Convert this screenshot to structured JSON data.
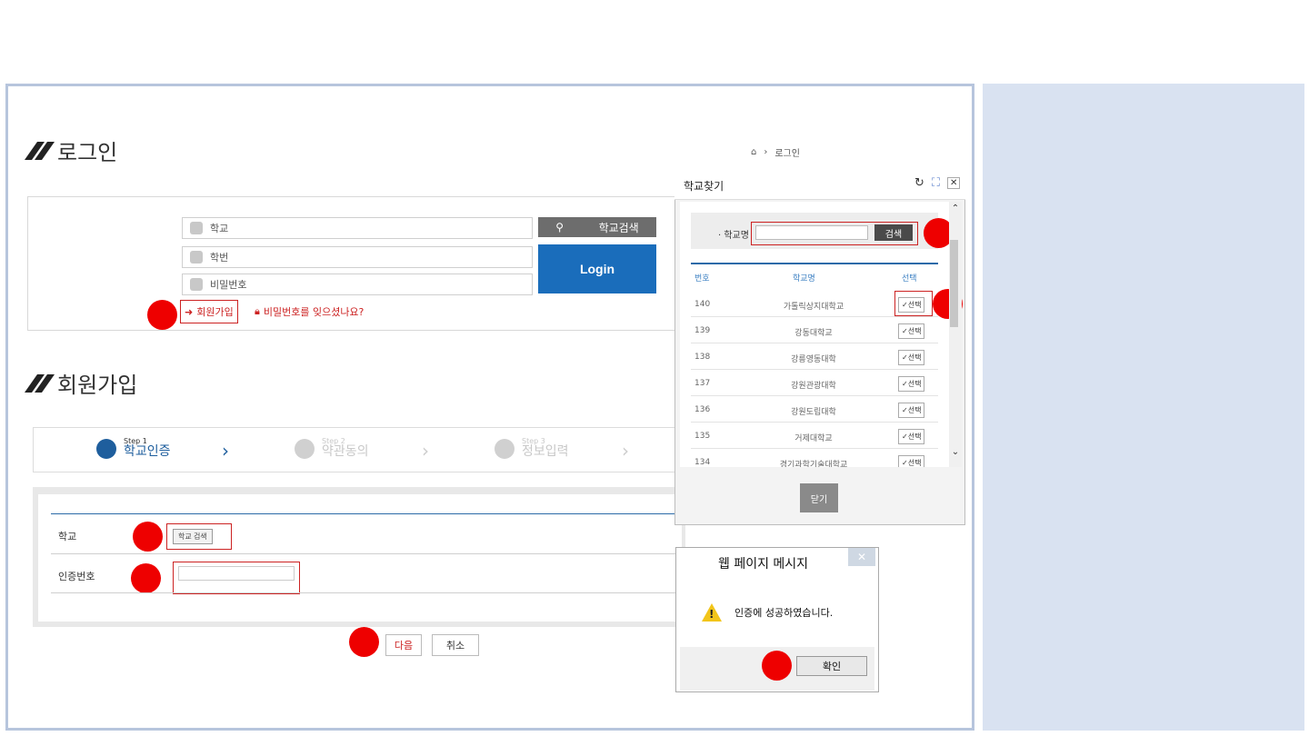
{
  "login": {
    "title": "로그인",
    "school_placeholder": "학교",
    "student_id_placeholder": "학번",
    "password_placeholder": "비밀번호",
    "school_search_button": "학교검색",
    "login_button": "Login",
    "join_link": "회원가입",
    "forgot_link": "비밀번호를 잊으셨나요?"
  },
  "signup": {
    "title": "회원가입",
    "steps": [
      {
        "step": "Step 1",
        "label": "학교인증"
      },
      {
        "step": "Step 2",
        "label": "약관동의"
      },
      {
        "step": "Step 3",
        "label": "정보입력"
      }
    ],
    "school_label": "학교",
    "school_search_button": "학교 검색",
    "auth_code_label": "인증번호",
    "next_button": "다음",
    "cancel_button": "취소"
  },
  "breadcrumb": {
    "current": "로그인"
  },
  "school_finder": {
    "title": "학교찾기",
    "search_label": "· 학교명",
    "search_button": "검색",
    "columns": [
      "번호",
      "학교명",
      "선택"
    ],
    "select_label": "✓선택",
    "rows": [
      {
        "no": "140",
        "name": "가톨릭상지대학교"
      },
      {
        "no": "139",
        "name": "강동대학교"
      },
      {
        "no": "138",
        "name": "강릉영동대학"
      },
      {
        "no": "137",
        "name": "강원관광대학"
      },
      {
        "no": "136",
        "name": "강원도립대학"
      },
      {
        "no": "135",
        "name": "거제대학교"
      },
      {
        "no": "134",
        "name": "경기과학기술대학교"
      }
    ],
    "close_button": "닫기"
  },
  "message_dialog": {
    "title": "웹 페이지 메시지",
    "text": "인증에 성공하였습니다.",
    "ok_button": "확인"
  },
  "colors": {
    "accent": "#1a6dbb",
    "highlight": "#ee0000",
    "panel": "#d9e2f1"
  }
}
